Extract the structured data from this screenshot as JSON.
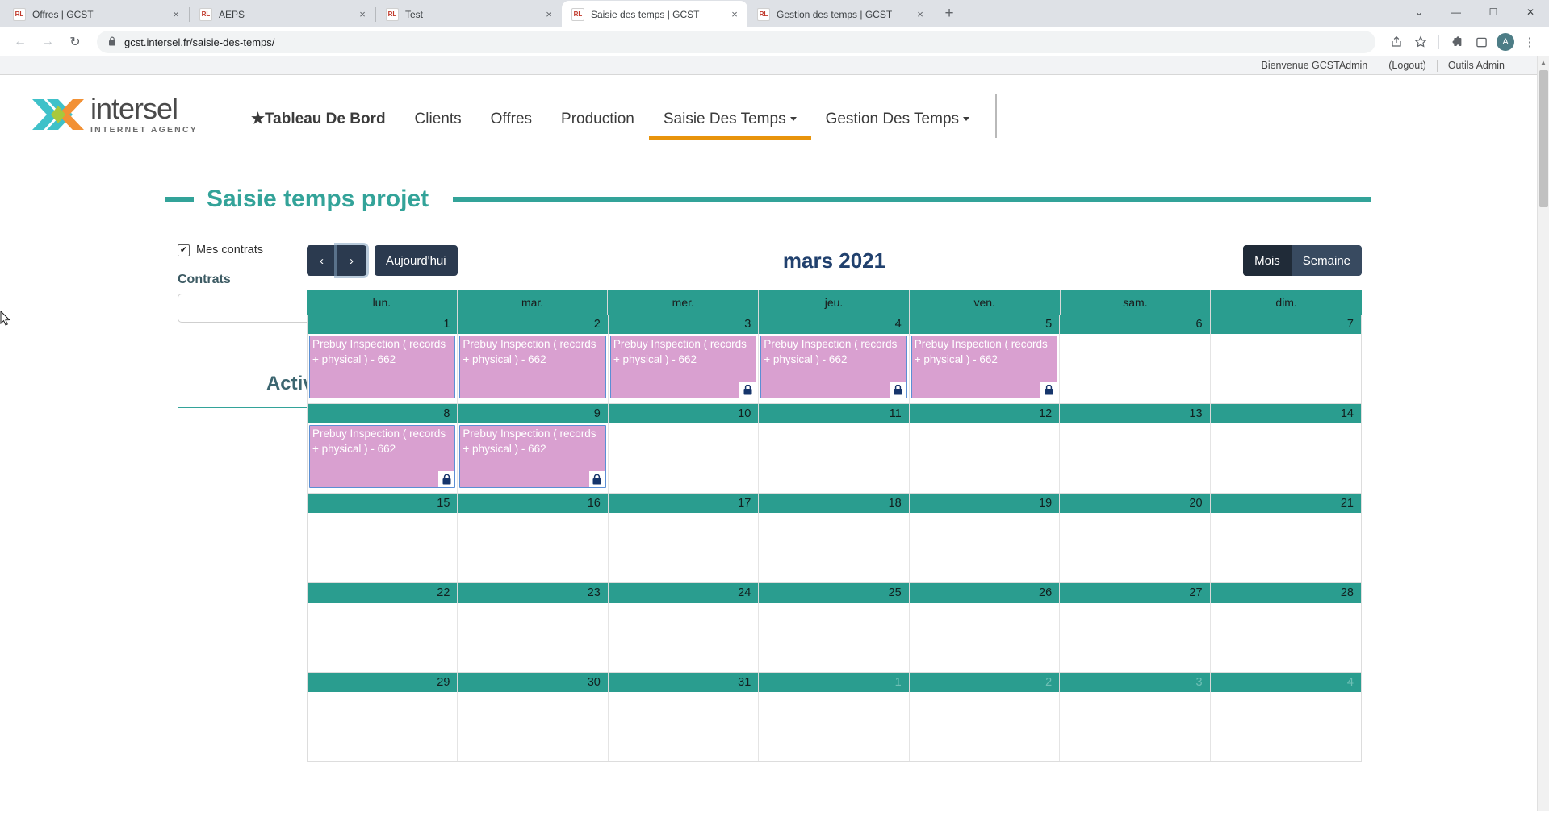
{
  "browser": {
    "tabs": [
      {
        "title": "Offres | GCST",
        "favicon": "RL",
        "active": false
      },
      {
        "title": "AEPS",
        "favicon": "RL",
        "active": false
      },
      {
        "title": "Test",
        "favicon": "RL",
        "active": false
      },
      {
        "title": "Saisie des temps | GCST",
        "favicon": "RL",
        "active": true
      },
      {
        "title": "Gestion des temps | GCST",
        "favicon": "RL",
        "active": false
      }
    ],
    "new_tab_label": "+",
    "close_label": "×",
    "window_controls": {
      "minimize": "—",
      "maximize": "☐",
      "close": "✕",
      "list": "⌄"
    },
    "back_icon": "←",
    "forward_icon": "→",
    "reload_icon": "↻",
    "url": "gcst.intersel.fr/saisie-des-temps/",
    "lock_icon": "🔒",
    "toolbar_icons": [
      "share-icon",
      "bookmark-star-icon",
      "extensions-puzzle-icon",
      "sidepanel-icon"
    ],
    "profile_initial": "A",
    "menu_icon": "⋮"
  },
  "utility": {
    "welcome": "Bienvenue GCSTAdmin",
    "logout": "(Logout)",
    "admin_tools": "Outils Admin"
  },
  "brand": {
    "name": "intersel",
    "tagline": "INTERNET AGENCY",
    "teal": "#3fc1c9",
    "orange": "#f29135",
    "green": "#a8c83c"
  },
  "nav": {
    "items": [
      {
        "label": "★Tableau De Bord",
        "bold": true,
        "caret": false,
        "active": false
      },
      {
        "label": "Clients",
        "bold": false,
        "caret": false,
        "active": false
      },
      {
        "label": "Offres",
        "bold": false,
        "caret": false,
        "active": false
      },
      {
        "label": "Production",
        "bold": false,
        "caret": false,
        "active": false
      },
      {
        "label": "Saisie Des Temps",
        "bold": false,
        "caret": true,
        "active": true
      },
      {
        "label": "Gestion Des Temps",
        "bold": false,
        "caret": true,
        "active": false
      }
    ],
    "active_underline_color": "#e8940c"
  },
  "page": {
    "title": "Saisie temps projet",
    "accent_color": "#33a399"
  },
  "sidebar": {
    "my_contracts_label": "Mes contrats",
    "my_contracts_checked": true,
    "check_glyph": "✔",
    "contracts_label": "Contrats",
    "contracts_value": "",
    "contracts_placeholder": "",
    "activities_title": "Activités"
  },
  "calendar": {
    "prev_label": "‹",
    "next_label": "›",
    "today_label": "Aujourd'hui",
    "title": "mars 2021",
    "views": [
      {
        "label": "Mois",
        "active": true
      },
      {
        "label": "Semaine",
        "active": false
      }
    ],
    "day_headers": [
      "lun.",
      "mar.",
      "mer.",
      "jeu.",
      "ven.",
      "sam.",
      "dim."
    ],
    "header_color": "#2a9d8f",
    "event_color": "#d9a0d0",
    "weeks": [
      {
        "days": [
          {
            "num": "1",
            "other": false,
            "event": {
              "text": "Prebuy Inspection ( records + physical ) - 662",
              "locked": false
            }
          },
          {
            "num": "2",
            "other": false,
            "event": {
              "text": "Prebuy Inspection ( records + physical ) - 662",
              "locked": false
            }
          },
          {
            "num": "3",
            "other": false,
            "event": {
              "text": "Prebuy Inspection ( records + physical ) - 662",
              "locked": true
            }
          },
          {
            "num": "4",
            "other": false,
            "event": {
              "text": "Prebuy Inspection ( records + physical ) - 662",
              "locked": true
            }
          },
          {
            "num": "5",
            "other": false,
            "event": {
              "text": "Prebuy Inspection ( records + physical ) - 662",
              "locked": true
            }
          },
          {
            "num": "6",
            "other": false,
            "event": null
          },
          {
            "num": "7",
            "other": false,
            "event": null
          }
        ]
      },
      {
        "days": [
          {
            "num": "8",
            "other": false,
            "event": {
              "text": "Prebuy Inspection ( records + physical ) - 662",
              "locked": true
            }
          },
          {
            "num": "9",
            "other": false,
            "event": {
              "text": "Prebuy Inspection ( records + physical ) - 662",
              "locked": true
            }
          },
          {
            "num": "10",
            "other": false,
            "event": null
          },
          {
            "num": "11",
            "other": false,
            "event": null
          },
          {
            "num": "12",
            "other": false,
            "event": null
          },
          {
            "num": "13",
            "other": false,
            "event": null
          },
          {
            "num": "14",
            "other": false,
            "event": null
          }
        ]
      },
      {
        "days": [
          {
            "num": "15",
            "other": false,
            "event": null
          },
          {
            "num": "16",
            "other": false,
            "event": null
          },
          {
            "num": "17",
            "other": false,
            "event": null
          },
          {
            "num": "18",
            "other": false,
            "event": null
          },
          {
            "num": "19",
            "other": false,
            "event": null
          },
          {
            "num": "20",
            "other": false,
            "event": null
          },
          {
            "num": "21",
            "other": false,
            "event": null
          }
        ]
      },
      {
        "days": [
          {
            "num": "22",
            "other": false,
            "event": null
          },
          {
            "num": "23",
            "other": false,
            "event": null
          },
          {
            "num": "24",
            "other": false,
            "event": null
          },
          {
            "num": "25",
            "other": false,
            "event": null
          },
          {
            "num": "26",
            "other": false,
            "event": null
          },
          {
            "num": "27",
            "other": false,
            "event": null
          },
          {
            "num": "28",
            "other": false,
            "event": null
          }
        ]
      },
      {
        "days": [
          {
            "num": "29",
            "other": false,
            "event": null
          },
          {
            "num": "30",
            "other": false,
            "event": null
          },
          {
            "num": "31",
            "other": false,
            "event": null
          },
          {
            "num": "1",
            "other": true,
            "event": null
          },
          {
            "num": "2",
            "other": true,
            "event": null
          },
          {
            "num": "3",
            "other": true,
            "event": null
          },
          {
            "num": "4",
            "other": true,
            "event": null
          }
        ]
      }
    ]
  }
}
